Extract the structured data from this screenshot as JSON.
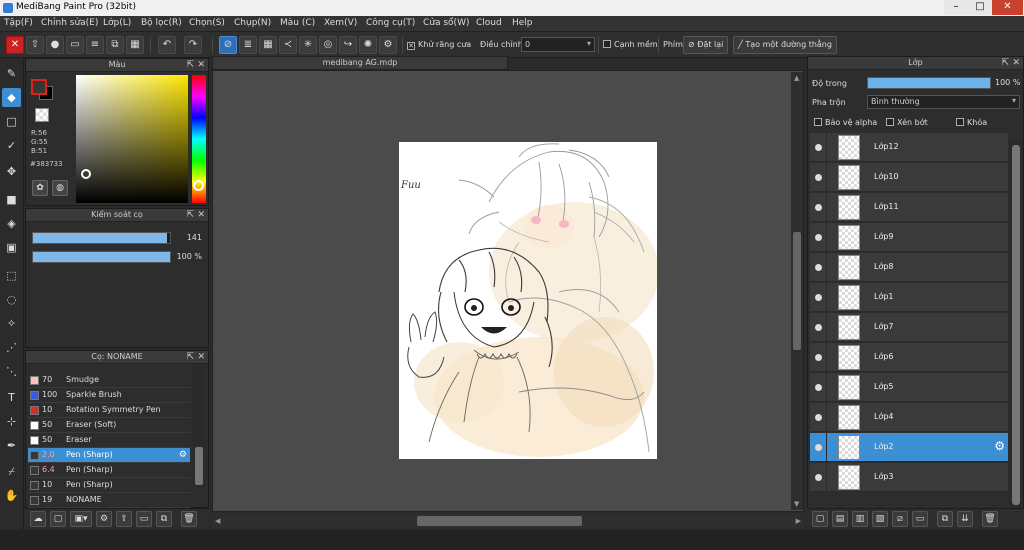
{
  "window": {
    "title": "MediBang Paint Pro (32bit)"
  },
  "menu": [
    "Tập(F)",
    "Chỉnh sửa(E)",
    "Lớp(L)",
    "Bộ lọc(R)",
    "Chọn(S)",
    "Chụp(N)",
    "Màu (C)",
    "Xem(V)",
    "Công cụ(T)",
    "Cửa sổ(W)",
    "Cloud",
    "Help"
  ],
  "toolbar": {
    "antialias_label": "Khử răng cưa",
    "antialias_checked": true,
    "adjust_label": "Điều chỉnh",
    "adjust_value": "0",
    "sharp_edge_label": "Cạnh mềm",
    "sharp_edge_checked": false,
    "brush_label": "Phím",
    "reset_label": "Đặt lại",
    "line_label": "Tạo một đường thẳng"
  },
  "color_panel": {
    "title": "Màu",
    "r": "R:56",
    "g": "G:55",
    "b": "B:51",
    "hex": "#383733",
    "fg_color": "#383733"
  },
  "brush_control": {
    "title": "Kiểm soát cọ",
    "size_value": "141",
    "size_fraction": 0.98,
    "opacity_value": "100 %",
    "opacity_fraction": 1.0
  },
  "brush_panel": {
    "title": "Cọ: NONAME",
    "items": [
      {
        "size": "70",
        "name": "Smudge",
        "color": "#f4c9b0"
      },
      {
        "size": "100",
        "name": "Sparkle Brush",
        "color": "#3a5be0"
      },
      {
        "size": "10",
        "name": "Rotation Symmetry Pen",
        "color": "#e02b2b"
      },
      {
        "size": "50",
        "name": "Eraser (Soft)",
        "color": "#ffffff"
      },
      {
        "size": "50",
        "name": "Eraser",
        "color": "#ffffff"
      },
      {
        "size": "2.0",
        "name": "Pen (Sharp)",
        "color": "#383733",
        "selected": true
      },
      {
        "size": "6.4",
        "name": "Pen (Sharp)",
        "color": "#383733"
      },
      {
        "size": "10",
        "name": "Pen (Sharp)",
        "color": "#383733"
      },
      {
        "size": "19",
        "name": "NONAME",
        "color": "#383733"
      }
    ]
  },
  "canvas": {
    "tab_title": "medibang AG.mdp",
    "signature_text": "Fuu"
  },
  "layer_panel": {
    "title": "Lớp",
    "opacity_label": "Độ trong",
    "opacity_value": "100 %",
    "opacity_fraction": 1.0,
    "blend_label": "Pha trộn",
    "blend_value": "Bình thường",
    "protect_alpha": "Bảo vệ alpha",
    "clipping": "Xén bớt",
    "lock": "Khóa",
    "layers": [
      {
        "name": "Lớp12"
      },
      {
        "name": "Lớp10"
      },
      {
        "name": "Lớp11"
      },
      {
        "name": "Lớp9"
      },
      {
        "name": "Lớp8"
      },
      {
        "name": "Lớp1"
      },
      {
        "name": "Lớp7"
      },
      {
        "name": "Lớp6"
      },
      {
        "name": "Lớp5"
      },
      {
        "name": "Lớp4"
      },
      {
        "name": "Lớp2",
        "selected": true
      },
      {
        "name": "Lớp3"
      }
    ]
  }
}
